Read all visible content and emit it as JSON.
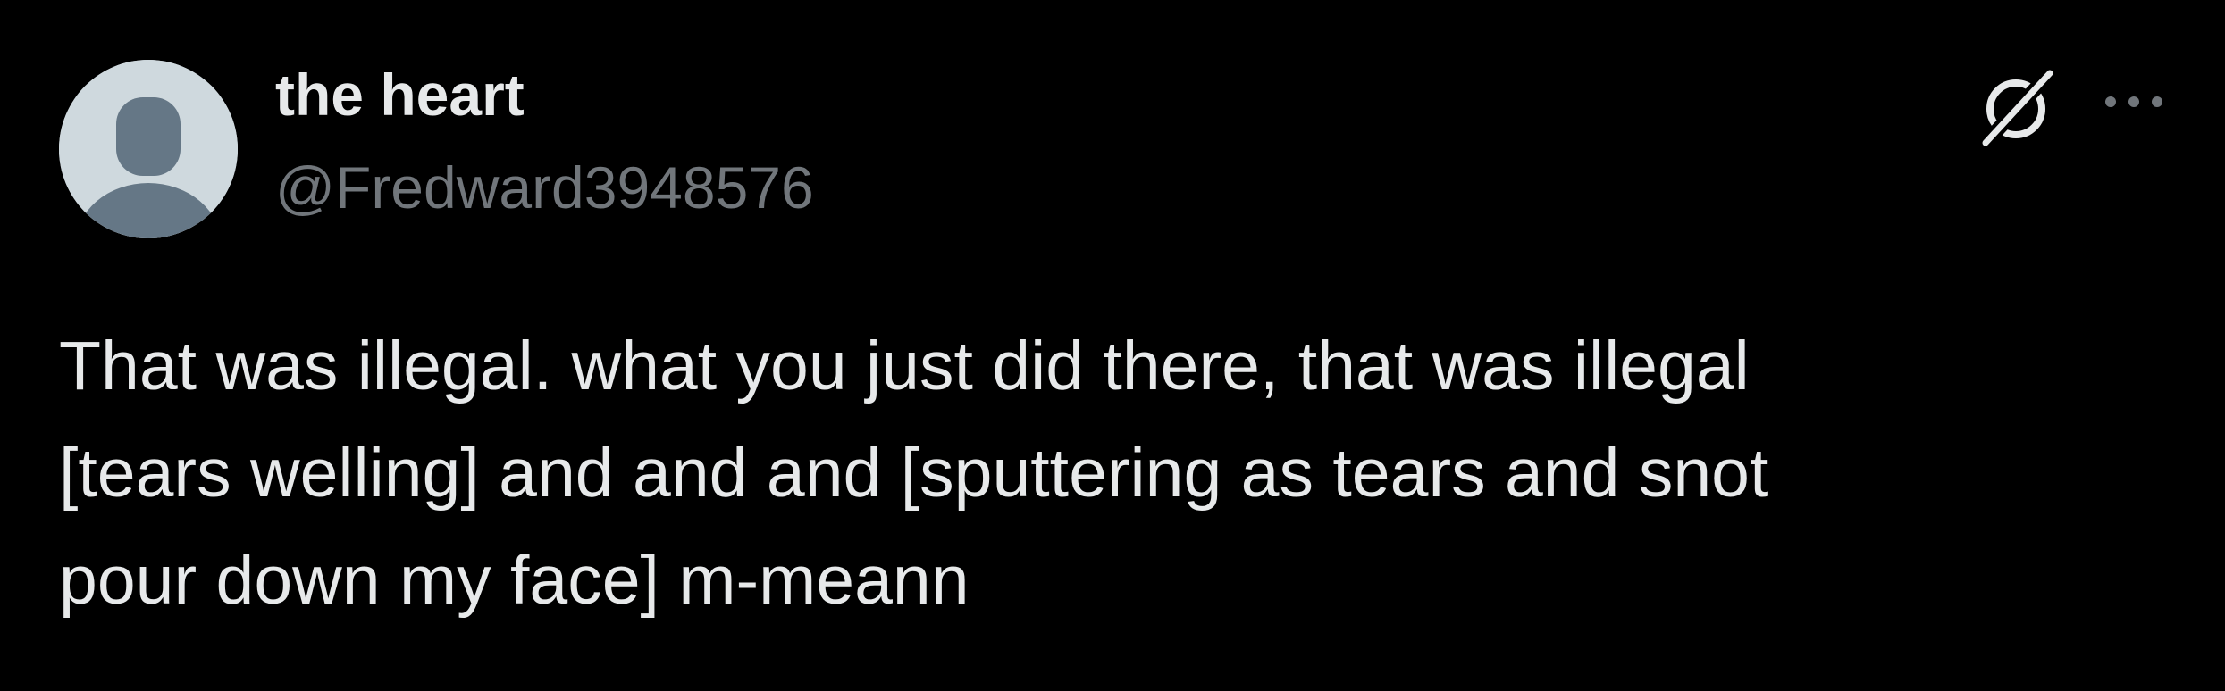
{
  "tweet": {
    "author": {
      "display_name": "the heart",
      "handle": "@Fredward3948576",
      "avatar_icon": "default-avatar-icon"
    },
    "text_lines": [
      "That was illegal. what you just did there, that was illegal",
      "[tears welling] and and and [sputtering as tears and snot",
      "pour down my face] m-meann"
    ],
    "icons": {
      "grok": "grok-icon",
      "more": "more-options-icon"
    }
  },
  "colors": {
    "background": "#000000",
    "primary_text": "#e7e9ea",
    "secondary_text": "#71767b",
    "avatar_bg": "#cfd9de",
    "avatar_figure": "#657786"
  }
}
